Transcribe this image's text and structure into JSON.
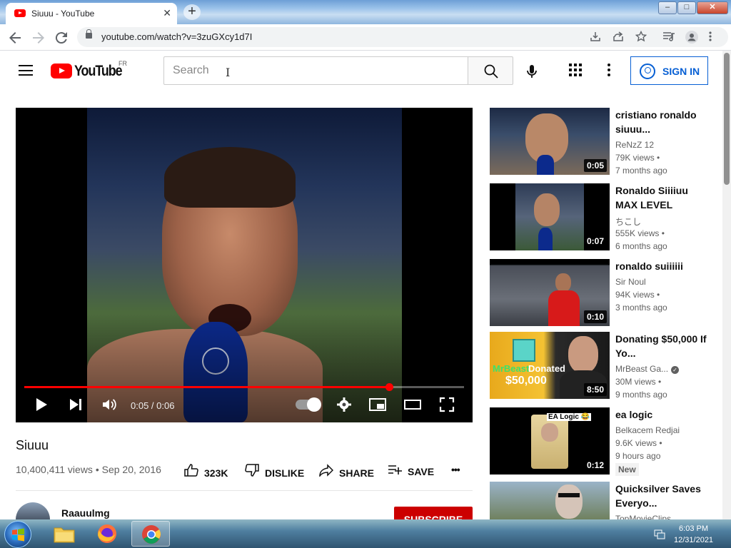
{
  "browser": {
    "tab_title": "Siuuu - YouTube",
    "new_tab_label": "+",
    "close_tab_label": "✕",
    "url": "youtube.com/watch?v=3zuGXcy1d7I",
    "window_buttons": {
      "minimize": "–",
      "maximize": "□",
      "close": "✕"
    }
  },
  "youtube": {
    "logo_text": "YouTube",
    "country_code": "FR",
    "search_placeholder": "Search",
    "sign_in_label": "SIGN IN"
  },
  "player": {
    "time": "0:05 / 0:06",
    "progress_fraction": 0.83
  },
  "video": {
    "title": "Siuuu",
    "meta": "10,400,411 views • Sep 20, 2016",
    "likes": "323K",
    "dislike_label": "DISLIKE",
    "share_label": "SHARE",
    "save_label": "SAVE",
    "more_label": "•••",
    "channel_name": "Raauulmg",
    "subscribe_label": "SUBSCRIBE"
  },
  "recommended": [
    {
      "title": "cristiano ronaldo siuuu...",
      "channel": "ReNzZ 12",
      "views": "79K views •",
      "age": "7 months ago",
      "duration": "0:05"
    },
    {
      "title": "Ronaldo Siiiiuu MAX LEVEL",
      "channel": "ちこし",
      "views": "555K views •",
      "age": "6 months ago",
      "duration": "0:07"
    },
    {
      "title": "ronaldo suiiiiii",
      "channel": "Sir Noul",
      "views": "94K views •",
      "age": "3 months ago",
      "duration": "0:10"
    },
    {
      "title": "Donating $50,000 If Yo...",
      "channel": "MrBeast Ga...",
      "views": "30M views •",
      "age": "9 months ago",
      "duration": "8:50",
      "thumb_text_1": "MrBeast",
      "thumb_text_2": "Donated",
      "thumb_text_3": "$50,000"
    },
    {
      "title": "ea logic",
      "channel": "Belkacem Redjai",
      "views": "9.6K views •",
      "age": "9 hours ago",
      "duration": "0:12",
      "badge": "New",
      "thumb_text_1": "EA Logic 😂"
    },
    {
      "title": "Quicksilver Saves Everyo...",
      "channel": "TopMovieClips"
    }
  ],
  "taskbar": {
    "time": "6:03 PM",
    "date": "12/31/2021"
  }
}
